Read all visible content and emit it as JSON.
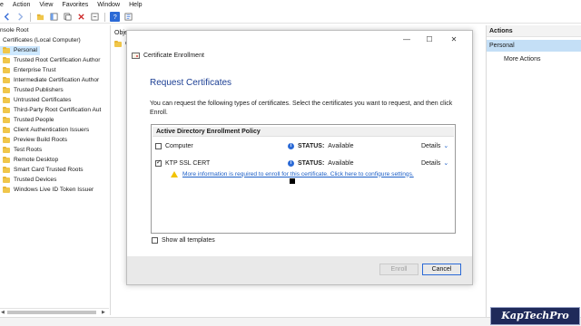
{
  "menu": [
    "e",
    "Action",
    "View",
    "Favorites",
    "Window",
    "Help"
  ],
  "tree": {
    "items": [
      {
        "label": "nsole Root",
        "folder": false,
        "indent": 0
      },
      {
        "label": "Certificates (Local Computer)",
        "folder": false,
        "indent": 1
      },
      {
        "label": "Personal",
        "folder": true,
        "indent": 1,
        "selected": true
      },
      {
        "label": "Trusted Root Certification Author",
        "folder": true,
        "indent": 1
      },
      {
        "label": "Enterprise Trust",
        "folder": true,
        "indent": 1
      },
      {
        "label": "Intermediate Certification Author",
        "folder": true,
        "indent": 1
      },
      {
        "label": "Trusted Publishers",
        "folder": true,
        "indent": 1
      },
      {
        "label": "Untrusted Certificates",
        "folder": true,
        "indent": 1
      },
      {
        "label": "Third-Party Root Certification Aut",
        "folder": true,
        "indent": 1
      },
      {
        "label": "Trusted People",
        "folder": true,
        "indent": 1
      },
      {
        "label": "Client Authentication Issuers",
        "folder": true,
        "indent": 1
      },
      {
        "label": "Preview Build Roots",
        "folder": true,
        "indent": 1
      },
      {
        "label": "Test Roots",
        "folder": true,
        "indent": 1
      },
      {
        "label": "Remote Desktop",
        "folder": true,
        "indent": 1
      },
      {
        "label": "Smart Card Trusted Roots",
        "folder": true,
        "indent": 1
      },
      {
        "label": "Trusted Devices",
        "folder": true,
        "indent": 1
      },
      {
        "label": "Windows Live ID Token Issuer",
        "folder": true,
        "indent": 1
      }
    ]
  },
  "middle": {
    "header": "Obje",
    "item": "C"
  },
  "actions": {
    "header": "Actions",
    "section": "Personal",
    "item": "More Actions"
  },
  "dialog": {
    "window_title": "Certificate Enrollment",
    "minimize": "—",
    "maximize": "☐",
    "close": "✕",
    "title": "Request Certificates",
    "description": "You can request the following types of certificates. Select the certificates you want to request, and then click Enroll.",
    "policy_header": "Active Directory Enrollment Policy",
    "templates": [
      {
        "name": "Computer",
        "checked": false,
        "status_label": "STATUS:",
        "status_value": "Available",
        "details": "Details"
      },
      {
        "name": "KTP SSL CERT",
        "checked": true,
        "status_label": "STATUS:",
        "status_value": "Available",
        "details": "Details"
      }
    ],
    "warning_link": "More information is required to enroll for this certificate. Click here to configure settings.",
    "show_all": "Show all templates",
    "enroll": "Enroll",
    "cancel": "Cancel"
  },
  "watermark": "KapTechPro",
  "colors": {
    "accent_blue": "#1c3f94",
    "link_blue": "#1c5fc7",
    "selection": "#cde8ff",
    "actions_section": "#c4dff6",
    "warning": "#f2c300",
    "watermark_bg": "#1f2a5a"
  }
}
